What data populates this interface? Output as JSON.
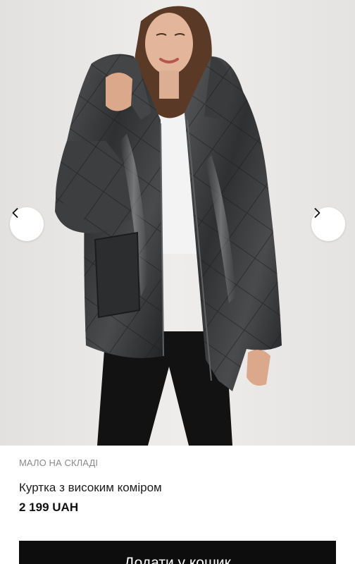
{
  "gallery": {
    "image": "model-wearing-dark-metallic-puffer-jacket",
    "prev_icon": "chevron-left-icon",
    "next_icon": "chevron-right-icon"
  },
  "product": {
    "stock_status": "МАЛО НА СКЛАДІ",
    "title": "Куртка з високим коміром",
    "price": "2 199 UAH"
  },
  "actions": {
    "add_to_cart_label": "Додати у кошик"
  },
  "colors": {
    "button_bg": "#0d0d0d",
    "stock_text": "#8a8a8a",
    "background": "#ffffff"
  }
}
